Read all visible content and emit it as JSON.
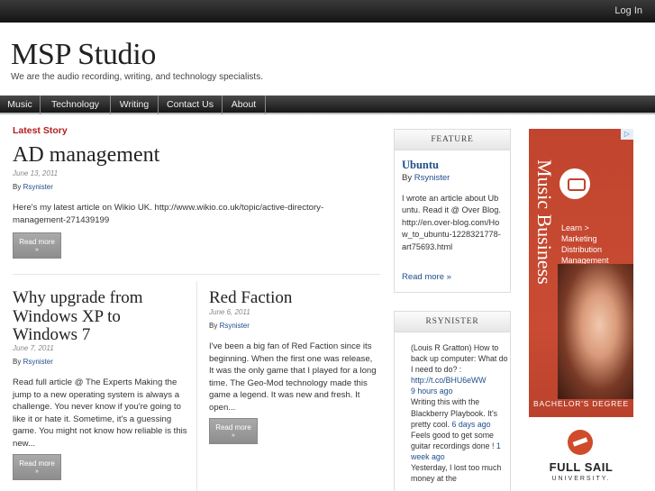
{
  "header": {
    "login": "Log In",
    "title": "MSP Studio",
    "description": "We are the audio recording, writing, and technology specialists."
  },
  "nav": [
    "Music",
    "Technology",
    "Writing",
    "Contact Us",
    "About"
  ],
  "latest_label": "Latest Story",
  "by_label": "By",
  "main_post": {
    "title": "AD management",
    "date": "June 13, 2011",
    "author": "Rsynister",
    "excerpt": "Here's my latest article on Wikio UK. http://www.wikio.co.uk/topic/active-directory-management-271439199",
    "read_more": "Read more",
    "arrow": "»"
  },
  "post_left": {
    "title": "Why upgrade from Windows XP to Windows 7",
    "date": "June 7, 2011",
    "author": "Rsynister",
    "excerpt": "Read full article @ The Experts Making the jump to a new operating system is always a challenge. You never know if you're going to like it or hate it. Sometime, it's a guessing game. You might not know how reliable is this new...",
    "read_more": "Read more",
    "arrow": "»"
  },
  "post_right": {
    "title": "Red Faction",
    "date": "June 6, 2011",
    "author": "Rsynister",
    "excerpt": "I've been a big fan of Red Faction since its beginning. When the first one was release, It was the only game that I played for a long time. The Geo-Mod technology made this game a legend. It was new and fresh. It open...",
    "read_more": "Read more",
    "arrow": "»"
  },
  "feature": {
    "heading": "FEATURE",
    "title": "Ubuntu",
    "by": "By",
    "author": "Rsynister",
    "text": "I wrote an article about Ubuntu. Read it @ Over Blog. http://en.over-blog.com/How_to_ubuntu-1228321778-art75693.html",
    "read_more": "Read more »"
  },
  "twitter": {
    "heading": "RSYNISTER",
    "tweets": [
      {
        "text": "(Louis R Gratton) How to back up computer: What do I need to do? : ",
        "link": "http://t.co/BHU6eWW",
        "when": "9 hours ago"
      },
      {
        "text": "Writing this with the Blackberry Playbook. It's pretty cool. ",
        "link": "",
        "when": "6 days ago"
      },
      {
        "text": "Feels good to get some guitar recordings done ! ",
        "link": "",
        "when": "1 week ago"
      },
      {
        "text": "Yesterday, I lost too much money at the",
        "link": "",
        "when": ""
      }
    ]
  },
  "ad": {
    "corner": "▷",
    "vertical": "Music Business",
    "lines": [
      "Learn >",
      "Marketing",
      "Distribution",
      "Management"
    ],
    "degree": "BACHELOR'S DEGREE",
    "school": "FULL SAIL",
    "univ": "UNIVERSITY."
  }
}
